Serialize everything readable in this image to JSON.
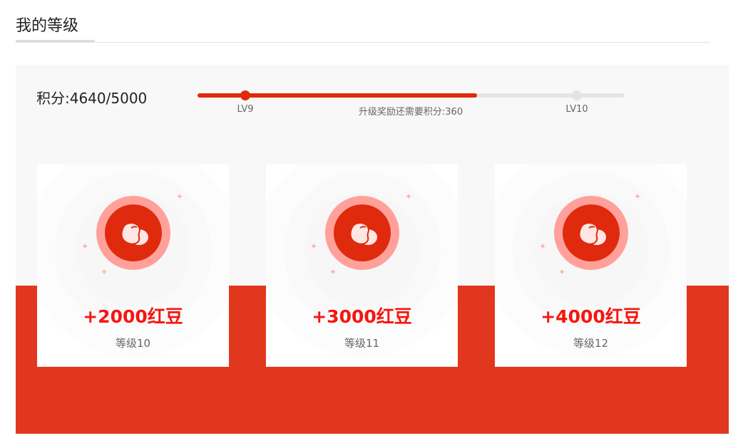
{
  "title": "我的等级",
  "progress": {
    "points_label": "积分:4640/5000",
    "current": 4640,
    "target": 5000,
    "fill_fraction": 0.655,
    "current_level": "LV9",
    "next_level": "LV10",
    "hint": "升级奖励还需要积分:360"
  },
  "rewards": [
    {
      "amount": "+2000红豆",
      "level": "等级10"
    },
    {
      "amount": "+3000红豆",
      "level": "等级11"
    },
    {
      "amount": "+4000红豆",
      "level": "等级12"
    }
  ],
  "colors": {
    "accent": "#e02a0d",
    "band": "#e2371f",
    "amount": "#f7150f"
  }
}
